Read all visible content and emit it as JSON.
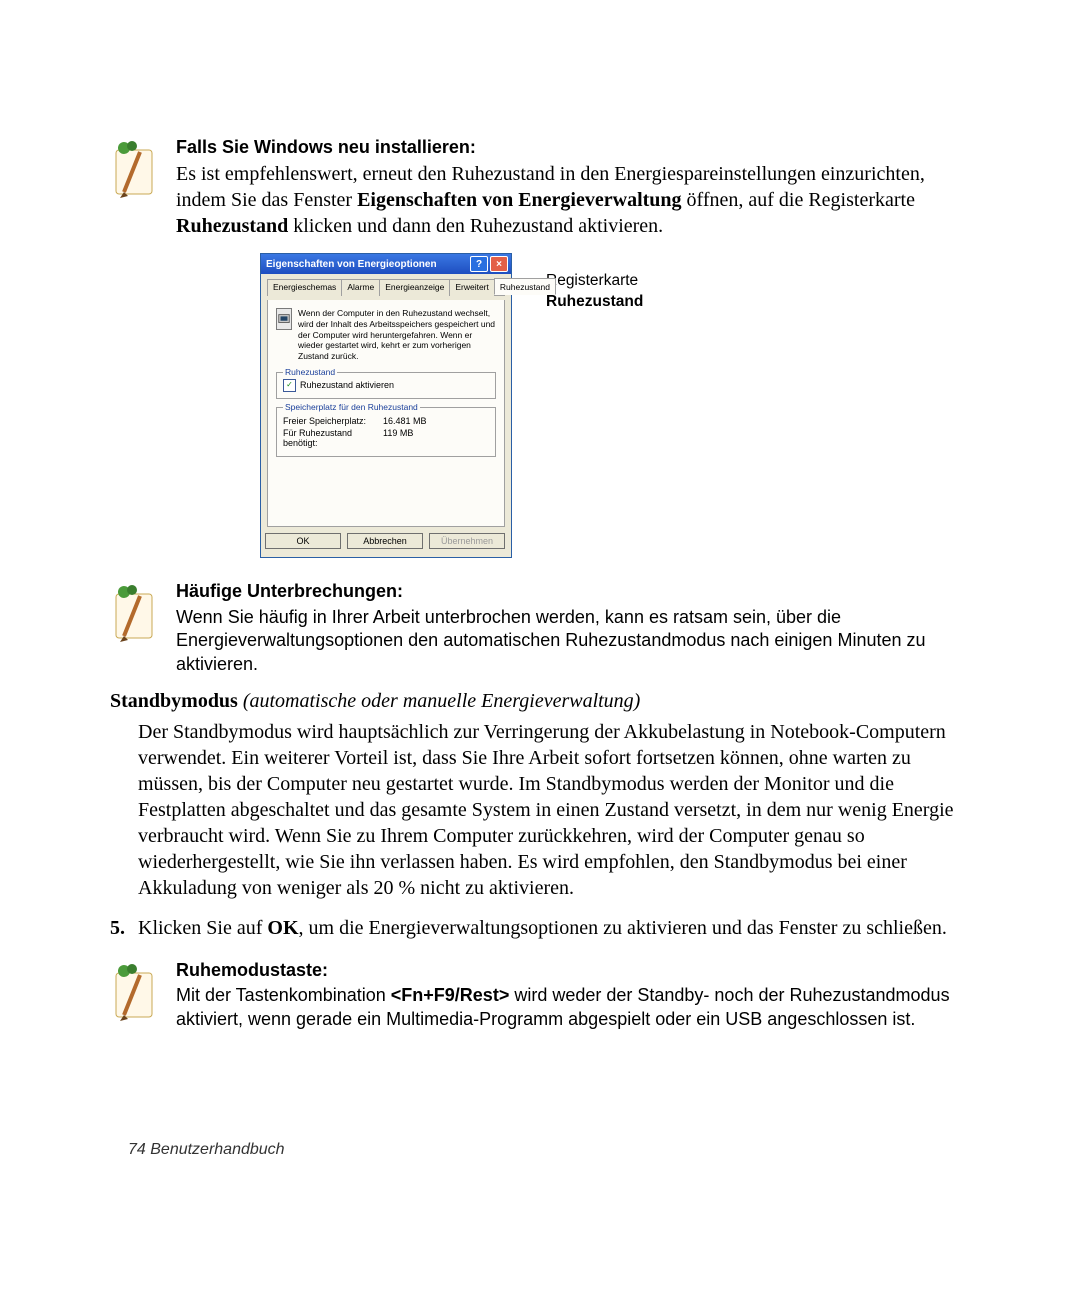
{
  "note1": {
    "title": "Falls Sie Windows neu installieren:",
    "body_before": "Es ist empfehlenswert, erneut den Ruhezustand in den Energiespareinstellungen einzurichten, indem Sie das Fenster ",
    "body_bold1": "Eigenschaften von Energieverwaltung",
    "body_mid": " öffnen, auf die Registerkarte ",
    "body_bold2": "Ruhezustand",
    "body_after": " klicken und dann den Ruhezustand aktivieren."
  },
  "dialog": {
    "title": "Eigenschaften von Energieoptionen",
    "tabs": {
      "t0": "Energieschemas",
      "t1": "Alarme",
      "t2": "Energieanzeige",
      "t3": "Erweitert",
      "t4": "Ruhezustand"
    },
    "info": "Wenn der Computer in den Ruhezustand wechselt, wird der Inhalt des Arbeitsspeichers gespeichert und der Computer wird heruntergefahren. Wenn er wieder gestartet wird, kehrt er zum vorherigen Zustand zurück.",
    "fieldset1": {
      "legend": "Ruhezustand",
      "checkbox_label": "Ruhezustand aktivieren"
    },
    "fieldset2": {
      "legend": "Speicherplatz für den Ruhezustand",
      "row1_k": "Freier Speicherplatz:",
      "row1_v": "16.481 MB",
      "row2_k": "Für Ruhezustand benötigt:",
      "row2_v": "119 MB"
    },
    "buttons": {
      "ok": "OK",
      "cancel": "Abbrechen",
      "apply": "Übernehmen"
    }
  },
  "callout": {
    "line1": "Registerkarte",
    "line2": "Ruhezustand"
  },
  "note2": {
    "title": "Häufige Unterbrechungen:",
    "body": "Wenn Sie häufig in Ihrer Arbeit unterbrochen werden, kann es ratsam sein, über die Energieverwaltungsoptionen den automatischen Ruhezustandmodus nach einigen Minuten zu aktivieren."
  },
  "section": {
    "bold": "Standbymodus",
    "italic": " (automatische oder manuelle Energieverwaltung)"
  },
  "standby_para": "Der Standbymodus wird hauptsächlich zur Verringerung der Akkubelastung in Notebook-Computern verwendet. Ein weiterer Vorteil ist, dass Sie Ihre Arbeit sofort fortsetzen können, ohne warten zu müssen, bis der Computer neu gestartet wurde. Im Standbymodus werden der Monitor und die Festplatten abgeschaltet und das gesamte System in einen Zustand versetzt, in dem nur wenig Energie verbraucht wird. Wenn Sie zu Ihrem Computer zurückkehren, wird der Computer genau so wiederhergestellt, wie Sie ihn verlassen haben. Es wird empfohlen, den Standbymodus bei einer Akkuladung von weniger als 20 % nicht zu aktivieren.",
  "step5": {
    "num": "5.",
    "pre": "Klicken Sie auf ",
    "bold": "OK",
    "post": ", um die Energieverwaltungsoptionen zu aktivieren und das Fenster zu schließen."
  },
  "note3": {
    "title": "Ruhemodustaste:",
    "pre": "Mit der Tastenkombination ",
    "bold": "<Fn+F9/Rest>",
    "post": " wird weder der Standby- noch der Ruhezustandmodus aktiviert, wenn gerade ein Multimedia-Programm abgespielt oder ein USB angeschlossen ist."
  },
  "footer": "74  Benutzerhandbuch"
}
